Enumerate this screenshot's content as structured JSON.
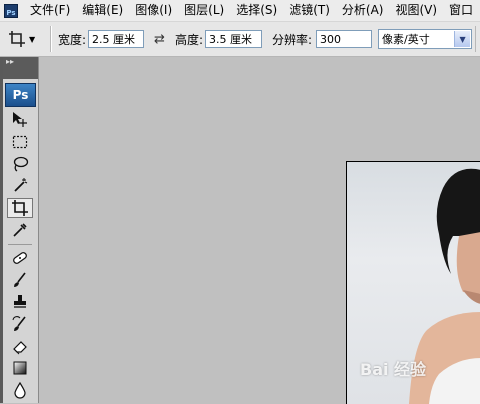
{
  "menubar": {
    "items": [
      {
        "label": "文件(F)"
      },
      {
        "label": "编辑(E)"
      },
      {
        "label": "图像(I)"
      },
      {
        "label": "图层(L)"
      },
      {
        "label": "选择(S)"
      },
      {
        "label": "滤镜(T)"
      },
      {
        "label": "分析(A)"
      },
      {
        "label": "视图(V)"
      },
      {
        "label": "窗口"
      }
    ]
  },
  "options": {
    "width_label": "宽度:",
    "width_value": "2.5 厘米",
    "swap_glyph": "⇄",
    "height_label": "高度:",
    "height_value": "3.5 厘米",
    "resolution_label": "分辨率:",
    "resolution_value": "300",
    "unit_selected": "像素/英寸"
  },
  "toolbox": {
    "app_logo": "Ps",
    "active_tool": "crop-tool"
  },
  "canvas": {
    "watermark": "Bai 经验"
  },
  "colors": {
    "workspace": "#c0c0c0",
    "ps_blue": "#1b4f8c"
  }
}
